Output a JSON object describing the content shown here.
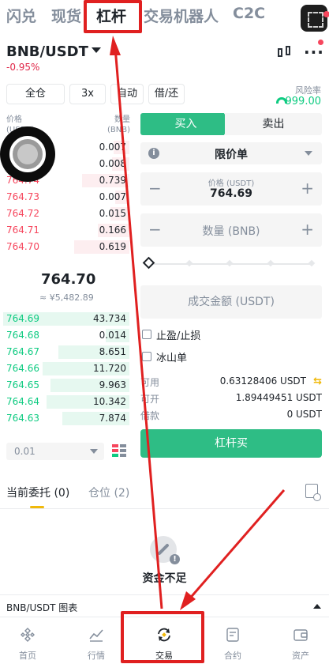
{
  "top_tabs": [
    "闪兑",
    "现货",
    "杠杆",
    "交易机器人",
    "C2C"
  ],
  "pair": {
    "symbol": "BNB/USDT",
    "change": "-0.95%"
  },
  "options": {
    "margin_mode": "全仓",
    "leverage": "3x",
    "auto": "自动",
    "borrow_repay": "借/还"
  },
  "risk": {
    "label": "风险率",
    "value": "999.00"
  },
  "orderbook": {
    "price_header": "价格\n(USDT)",
    "qty_header": "数量\n(BNB)",
    "asks": [
      {
        "price": "",
        "qty": "0.007"
      },
      {
        "price": "",
        "qty": "0.008"
      },
      {
        "price": "764.74",
        "qty": "0.739"
      },
      {
        "price": "764.73",
        "qty": "0.007"
      },
      {
        "price": "764.72",
        "qty": "0.015"
      },
      {
        "price": "764.71",
        "qty": "0.166"
      },
      {
        "price": "764.70",
        "qty": "0.619"
      }
    ],
    "last_price": "764.70",
    "last_fiat": "≈ ¥5,482.89",
    "bids": [
      {
        "price": "764.69",
        "qty": "43.734"
      },
      {
        "price": "764.68",
        "qty": "0.014"
      },
      {
        "price": "764.67",
        "qty": "8.651"
      },
      {
        "price": "764.66",
        "qty": "11.720"
      },
      {
        "price": "764.65",
        "qty": "9.963"
      },
      {
        "price": "764.64",
        "qty": "10.342"
      },
      {
        "price": "764.63",
        "qty": "7.874"
      }
    ],
    "depth": "0.01"
  },
  "form": {
    "buy_tab": "买入",
    "sell_tab": "卖出",
    "order_type": "限价单",
    "price_label": "价格 (USDT)",
    "price_value": "764.69",
    "qty_placeholder": "数量 (BNB)",
    "amount_placeholder": "成交金额 (USDT)",
    "tp_sl": "止盈/止损",
    "iceberg": "冰山单",
    "available_label": "可用",
    "available_value": "0.63128406 USDT",
    "openable_label": "可开",
    "openable_value": "1.89449451 USDT",
    "borrowed_label": "借款",
    "borrowed_value": "0 USDT",
    "submit": "杠杆买"
  },
  "orders": {
    "current_tab": "当前委托",
    "current_count": "(0)",
    "positions_tab": "仓位",
    "positions_count": "(2)",
    "empty_text": "资金不足"
  },
  "chart_bar": {
    "title": "BNB/USDT 图表"
  },
  "bottom_nav": [
    "首页",
    "行情",
    "交易",
    "合约",
    "资产"
  ],
  "colors": {
    "buy": "#2ebd85",
    "sell": "#f6465d",
    "accent": "#f0b90b",
    "highlight": "#e02020"
  }
}
